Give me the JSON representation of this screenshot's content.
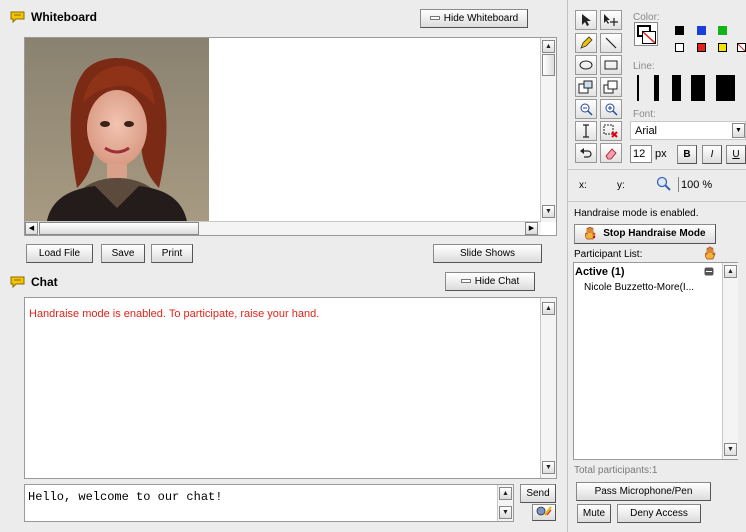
{
  "whiteboard": {
    "title": "Whiteboard",
    "hide_button": "Hide Whiteboard",
    "buttons": {
      "load": "Load File",
      "save": "Save",
      "print": "Print",
      "slides": "Slide Shows"
    }
  },
  "chat": {
    "title": "Chat",
    "hide_button": "Hide Chat",
    "system_message": "Handraise mode is enabled. To participate, raise your hand.",
    "system_color": "#e2231a",
    "input_value": "Hello, welcome to our chat!",
    "send_button": "Send"
  },
  "toolbox": {
    "color_label": "Color:",
    "line_label": "Line:",
    "font_label": "Font:",
    "font_value": "Arial",
    "font_size": "12",
    "font_unit": "px",
    "bold": "B",
    "italic": "I",
    "underline": "U",
    "x_label": "x:",
    "y_label": "y:",
    "zoom": "100 %",
    "palette_top": [
      "#000000",
      "#1a3fd8",
      "#13b31a"
    ],
    "palette_bottom": [
      "#ffffff",
      "#e2231a",
      "#f2e600"
    ]
  },
  "participants": {
    "handraise_status": "Handraise mode is enabled.",
    "stop_button": "Stop Handraise Mode",
    "list_label": "Participant List:",
    "active_header": "Active (1)",
    "members": [
      "Nicole Buzzetto-More(I..."
    ],
    "total": "Total participants:1",
    "pass_mic": "Pass Microphone/Pen",
    "mute": "Mute",
    "deny": "Deny Access"
  }
}
